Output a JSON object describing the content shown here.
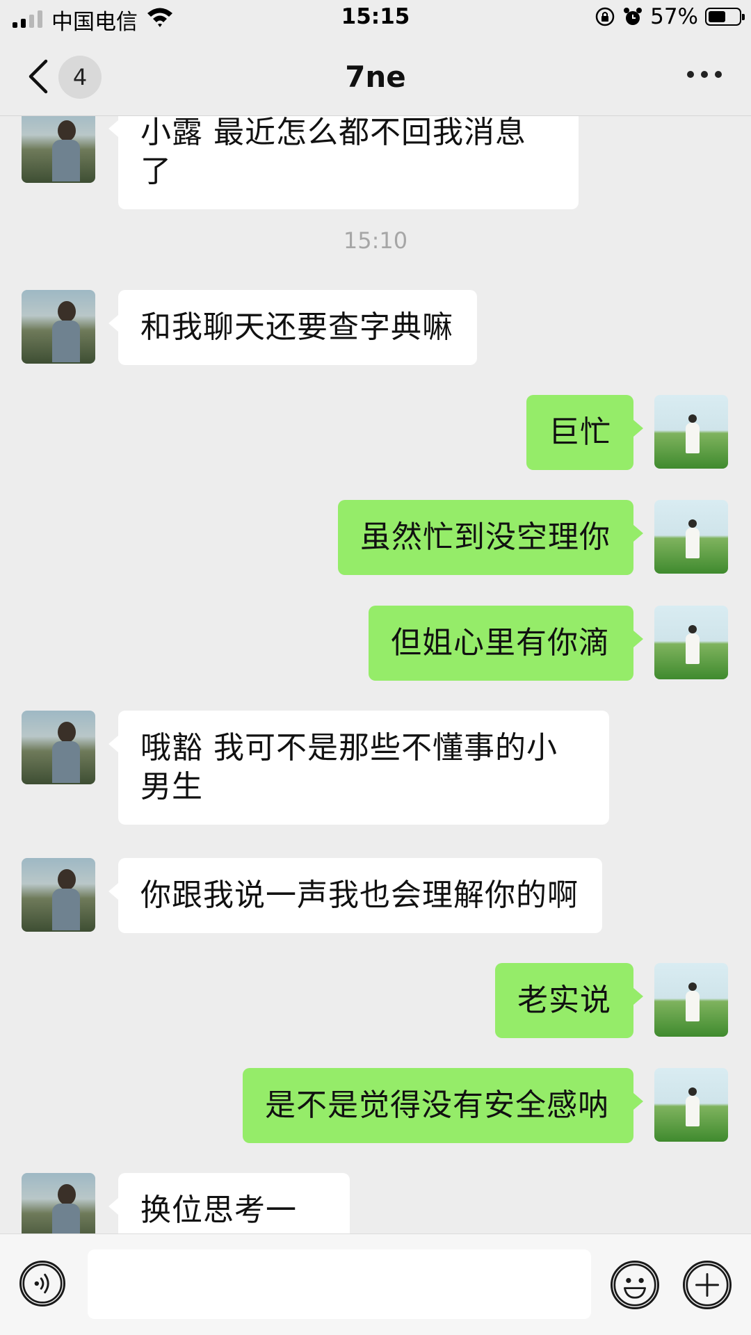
{
  "status_bar": {
    "carrier": "中国电信",
    "time": "15:15",
    "battery_text": "57%",
    "battery_level": 0.57,
    "icons": [
      "signal-icon",
      "wifi-icon",
      "screen-lock-icon",
      "alarm-icon",
      "battery-icon"
    ]
  },
  "nav": {
    "title": "7ne",
    "unread_count": "4",
    "back_icon": "chevron-left-icon",
    "more_icon": "more-dots-icon"
  },
  "messages": [
    {
      "side": "them",
      "text": "小露 最近怎么都不回我消息了"
    },
    {
      "type": "time",
      "text": "15:10"
    },
    {
      "side": "them",
      "text": "和我聊天还要查字典嘛"
    },
    {
      "side": "me",
      "text": "巨忙"
    },
    {
      "side": "me",
      "text": "虽然忙到没空理你"
    },
    {
      "side": "me",
      "text": "但姐心里有你滴"
    },
    {
      "side": "them",
      "text": "哦豁 我可不是那些不懂事的小男生"
    },
    {
      "side": "them",
      "text": "你跟我说一声我也会理解你的啊"
    },
    {
      "side": "me",
      "text": "老实说"
    },
    {
      "side": "me",
      "text": "是不是觉得没有安全感呐"
    },
    {
      "side": "them",
      "text": "换位思考一下"
    }
  ],
  "input_bar": {
    "text_value": "",
    "voice_icon": "voice-icon",
    "emoji_icon": "emoji-icon",
    "plus_icon": "plus-icon"
  },
  "colors": {
    "background": "#ededed",
    "bubble_me": "#95ec69",
    "bubble_them": "#ffffff",
    "timestamp": "#a6a6a6"
  }
}
